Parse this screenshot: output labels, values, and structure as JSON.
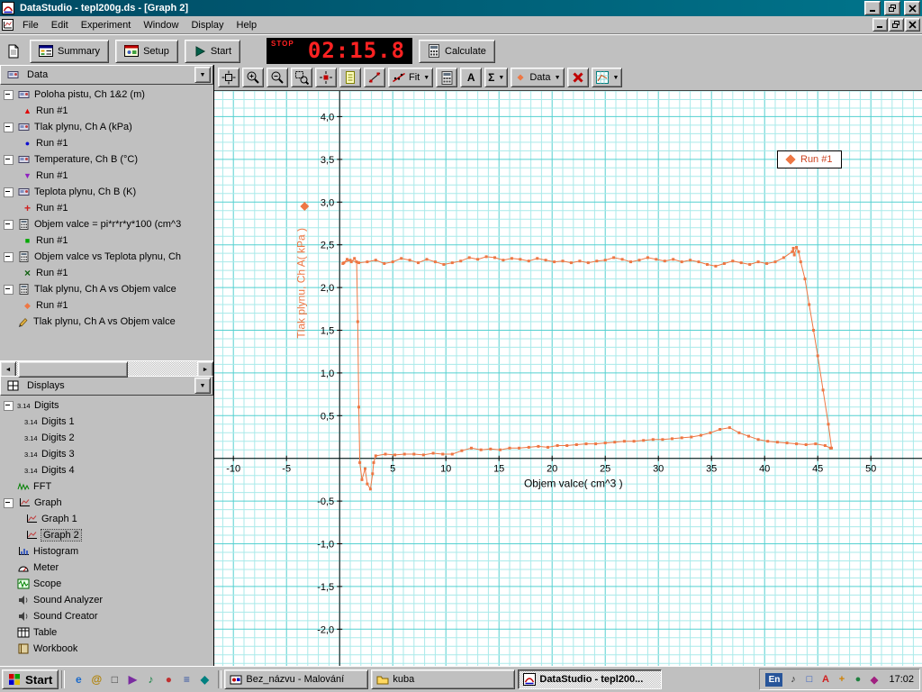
{
  "window": {
    "title": "DataStudio - tepl200g.ds - [Graph 2]"
  },
  "menu": {
    "items": [
      "File",
      "Edit",
      "Experiment",
      "Window",
      "Display",
      "Help"
    ]
  },
  "toolbar": {
    "summary": "Summary",
    "setup": "Setup",
    "start": "Start",
    "calculate": "Calculate",
    "timer_stop": "STOP",
    "timer_value": "02:15.8"
  },
  "graph_toolbar": {
    "buttons": [
      {
        "name": "scale-to-fit-button",
        "icon": "fitview"
      },
      {
        "name": "zoom-in-button",
        "icon": "zoomin"
      },
      {
        "name": "zoom-out-button",
        "icon": "zoomout"
      },
      {
        "name": "zoom-select-button",
        "icon": "zoomsel"
      },
      {
        "name": "smart-tool-button",
        "icon": "smart"
      },
      {
        "name": "note-tool-button",
        "icon": "note"
      },
      {
        "name": "slope-tool-button",
        "icon": "slope"
      },
      {
        "name": "fit-menu-button",
        "icon": "fitline",
        "label": "Fit",
        "dropdown": true
      },
      {
        "name": "calculator-tool-button",
        "icon": "calc"
      },
      {
        "name": "text-annotation-button",
        "label": "A",
        "bold": true
      },
      {
        "name": "statistics-menu-button",
        "label": "Σ",
        "bold": true,
        "dropdown": true
      },
      {
        "name": "data-menu-button",
        "icon": "datadiamond",
        "label": "Data",
        "dropdown": true
      },
      {
        "name": "delete-button",
        "icon": "delx"
      },
      {
        "name": "graph-settings-button",
        "icon": "gridset",
        "dropdown": true
      }
    ]
  },
  "sidebar": {
    "data_panel": {
      "title": "Data",
      "items": [
        {
          "icon": "sensor",
          "label": "Poloha pistu, Ch 1&2 (m)",
          "runs": [
            {
              "marker": "triangle-up",
              "color": "#e00000",
              "label": "Run #1"
            }
          ]
        },
        {
          "icon": "sensor",
          "label": "Tlak plynu, Ch A (kPa)",
          "runs": [
            {
              "marker": "circle",
              "color": "#1010d0",
              "label": "Run #1"
            }
          ]
        },
        {
          "icon": "sensor",
          "label": "Temperature, Ch B (°C)",
          "runs": [
            {
              "marker": "triangle-down",
              "color": "#9020c0",
              "label": "Run #1"
            }
          ]
        },
        {
          "icon": "sensor",
          "label": "Teplota plynu, Ch B (K)",
          "runs": [
            {
              "marker": "plus",
              "color": "#d02020",
              "label": "Run #1"
            }
          ]
        },
        {
          "icon": "calculator",
          "label": "Objem valce = pi*r*r*y*100 (cm^3",
          "runs": [
            {
              "marker": "square",
              "color": "#00a800",
              "label": "Run #1"
            }
          ]
        },
        {
          "icon": "calculator",
          "label": "Objem valce vs Teplota plynu, Ch",
          "runs": [
            {
              "marker": "x",
              "color": "#106010",
              "label": "Run #1"
            }
          ]
        },
        {
          "icon": "calculator",
          "label": "Tlak plynu, Ch A vs Objem valce",
          "runs": [
            {
              "marker": "diamond",
              "color": "#ee7744",
              "label": "Run #1"
            }
          ]
        },
        {
          "icon": "pen",
          "label": "Tlak plynu, Ch A vs Objem valce",
          "runs": []
        }
      ]
    },
    "displays_panel": {
      "title": "Displays",
      "items": [
        {
          "icon": "digits",
          "label": "Digits",
          "children": [
            {
              "icon": "digits",
              "label": "Digits 1"
            },
            {
              "icon": "digits",
              "label": "Digits 2"
            },
            {
              "icon": "digits",
              "label": "Digits 3"
            },
            {
              "icon": "digits",
              "label": "Digits 4"
            }
          ]
        },
        {
          "icon": "fft",
          "label": "FFT"
        },
        {
          "icon": "graph",
          "label": "Graph",
          "children": [
            {
              "icon": "graph",
              "label": "Graph 1"
            },
            {
              "icon": "graph",
              "label": "Graph 2",
              "selected": true
            }
          ]
        },
        {
          "icon": "histogram",
          "label": "Histogram"
        },
        {
          "icon": "meter",
          "label": "Meter"
        },
        {
          "icon": "scope",
          "label": "Scope"
        },
        {
          "icon": "speaker",
          "label": "Sound Analyzer"
        },
        {
          "icon": "speaker",
          "label": "Sound Creator"
        },
        {
          "icon": "table",
          "label": "Table"
        },
        {
          "icon": "workbook",
          "label": "Workbook"
        }
      ]
    }
  },
  "chart_data": {
    "type": "scatter",
    "title": "",
    "xlabel": "Objem valce( cm^3 )",
    "ylabel": "Tlak plynu, Ch A( kPa )",
    "legend": "Run #1",
    "series_color": "#ee7744",
    "grid_minor": "#aaeaea",
    "grid_major": "#55d0d0",
    "xlim": [
      -10,
      50
    ],
    "ylim": [
      -2,
      4
    ],
    "xview": [
      -11.8,
      54.9
    ],
    "yview": [
      -2.45,
      4.3
    ],
    "x_tick_step": 5,
    "y_tick_step": 0.5,
    "decimal_comma": true,
    "points": [
      [
        0.3,
        2.28
      ],
      [
        0.7,
        2.33
      ],
      [
        1.1,
        2.3
      ],
      [
        1.4,
        2.34
      ],
      [
        1.6,
        2.3
      ],
      [
        1.7,
        1.6
      ],
      [
        1.8,
        0.6
      ],
      [
        1.9,
        -0.05
      ],
      [
        2.1,
        -0.25
      ],
      [
        2.4,
        -0.12
      ],
      [
        2.6,
        -0.3
      ],
      [
        2.9,
        -0.36
      ],
      [
        3.1,
        -0.18
      ],
      [
        3.2,
        -0.05
      ],
      [
        3.4,
        0.03
      ],
      [
        4.3,
        0.05
      ],
      [
        5.2,
        0.04
      ],
      [
        6.1,
        0.05
      ],
      [
        7.0,
        0.05
      ],
      [
        7.9,
        0.04
      ],
      [
        8.8,
        0.06
      ],
      [
        9.7,
        0.05
      ],
      [
        10.6,
        0.05
      ],
      [
        11.5,
        0.09
      ],
      [
        12.4,
        0.12
      ],
      [
        13.3,
        0.1
      ],
      [
        14.2,
        0.11
      ],
      [
        15.1,
        0.1
      ],
      [
        16.0,
        0.12
      ],
      [
        16.9,
        0.12
      ],
      [
        17.8,
        0.13
      ],
      [
        18.7,
        0.14
      ],
      [
        19.6,
        0.13
      ],
      [
        20.5,
        0.15
      ],
      [
        21.4,
        0.15
      ],
      [
        22.3,
        0.16
      ],
      [
        23.2,
        0.17
      ],
      [
        24.1,
        0.17
      ],
      [
        25.0,
        0.18
      ],
      [
        25.9,
        0.19
      ],
      [
        26.8,
        0.2
      ],
      [
        27.7,
        0.2
      ],
      [
        28.6,
        0.21
      ],
      [
        29.5,
        0.22
      ],
      [
        30.4,
        0.22
      ],
      [
        31.3,
        0.23
      ],
      [
        32.2,
        0.24
      ],
      [
        33.1,
        0.25
      ],
      [
        34.0,
        0.27
      ],
      [
        34.9,
        0.3
      ],
      [
        35.8,
        0.34
      ],
      [
        36.7,
        0.36
      ],
      [
        37.6,
        0.3
      ],
      [
        38.5,
        0.26
      ],
      [
        39.4,
        0.22
      ],
      [
        40.3,
        0.2
      ],
      [
        41.2,
        0.19
      ],
      [
        42.1,
        0.18
      ],
      [
        43.0,
        0.17
      ],
      [
        43.9,
        0.16
      ],
      [
        44.8,
        0.17
      ],
      [
        45.7,
        0.15
      ],
      [
        46.2,
        0.12
      ],
      [
        46.3,
        0.12
      ],
      [
        46.0,
        0.4
      ],
      [
        45.5,
        0.8
      ],
      [
        45.0,
        1.2
      ],
      [
        44.6,
        1.5
      ],
      [
        44.2,
        1.8
      ],
      [
        43.8,
        2.1
      ],
      [
        43.4,
        2.3
      ],
      [
        43.2,
        2.42
      ],
      [
        43.0,
        2.47
      ],
      [
        42.8,
        2.38
      ],
      [
        42.7,
        2.46
      ],
      [
        42.6,
        2.42
      ],
      [
        41.8,
        2.35
      ],
      [
        41.0,
        2.3
      ],
      [
        40.2,
        2.28
      ],
      [
        39.4,
        2.3
      ],
      [
        38.6,
        2.27
      ],
      [
        37.8,
        2.29
      ],
      [
        37.0,
        2.31
      ],
      [
        36.2,
        2.28
      ],
      [
        35.4,
        2.25
      ],
      [
        34.6,
        2.27
      ],
      [
        33.8,
        2.3
      ],
      [
        33.0,
        2.32
      ],
      [
        32.2,
        2.3
      ],
      [
        31.4,
        2.33
      ],
      [
        30.6,
        2.31
      ],
      [
        29.8,
        2.33
      ],
      [
        29.0,
        2.35
      ],
      [
        28.2,
        2.32
      ],
      [
        27.4,
        2.3
      ],
      [
        26.6,
        2.33
      ],
      [
        25.8,
        2.35
      ],
      [
        25.0,
        2.32
      ],
      [
        24.2,
        2.31
      ],
      [
        23.4,
        2.29
      ],
      [
        22.6,
        2.31
      ],
      [
        21.8,
        2.29
      ],
      [
        21.0,
        2.31
      ],
      [
        20.2,
        2.3
      ],
      [
        19.4,
        2.32
      ],
      [
        18.6,
        2.34
      ],
      [
        17.8,
        2.31
      ],
      [
        17.0,
        2.33
      ],
      [
        16.2,
        2.34
      ],
      [
        15.4,
        2.32
      ],
      [
        14.6,
        2.35
      ],
      [
        13.8,
        2.36
      ],
      [
        13.0,
        2.33
      ],
      [
        12.2,
        2.35
      ],
      [
        11.4,
        2.31
      ],
      [
        10.6,
        2.29
      ],
      [
        9.8,
        2.27
      ],
      [
        9.0,
        2.3
      ],
      [
        8.2,
        2.33
      ],
      [
        7.4,
        2.29
      ],
      [
        6.6,
        2.32
      ],
      [
        5.8,
        2.34
      ],
      [
        5.0,
        2.3
      ],
      [
        4.2,
        2.28
      ],
      [
        3.4,
        2.32
      ],
      [
        2.6,
        2.3
      ],
      [
        1.8,
        2.29
      ],
      [
        1.0,
        2.32
      ],
      [
        0.4,
        2.29
      ]
    ]
  },
  "taskbar": {
    "start_label": "Start",
    "quick_launch": [
      {
        "name": "internet-explorer-icon",
        "glyph": "e",
        "color": "#1b6acb"
      },
      {
        "name": "mail-icon",
        "glyph": "@",
        "color": "#b08000"
      },
      {
        "name": "show-desktop-icon",
        "glyph": "□",
        "color": "#404040"
      },
      {
        "name": "media-player-icon",
        "glyph": "▶",
        "color": "#7a2ca0"
      },
      {
        "name": "sound-recorder-icon",
        "glyph": "♪",
        "color": "#108040"
      },
      {
        "name": "browser-icon",
        "glyph": "●",
        "color": "#c03030"
      },
      {
        "name": "document-icon",
        "glyph": "≡",
        "color": "#3050a0"
      },
      {
        "name": "tools-icon",
        "glyph": "◆",
        "color": "#008080"
      }
    ],
    "tasks": [
      {
        "name": "task-paint",
        "label": "Bez_názvu - Malování",
        "icon": "paint",
        "active": false
      },
      {
        "name": "task-folder-kuba",
        "label": "kuba",
        "icon": "folder",
        "active": false
      },
      {
        "name": "task-datastudio",
        "label": "DataStudio - tepl200...",
        "icon": "datastudio",
        "active": true
      }
    ],
    "tray": {
      "language": "En",
      "icons": [
        {
          "name": "volume-icon",
          "glyph": "♪",
          "color": "#303030"
        },
        {
          "name": "display-icon",
          "glyph": "□",
          "color": "#2050c0"
        },
        {
          "name": "antivirus-icon",
          "glyph": "A",
          "color": "#d02020"
        },
        {
          "name": "scheduler-icon",
          "glyph": "+",
          "color": "#d08000"
        },
        {
          "name": "network-icon",
          "glyph": "●",
          "color": "#208040"
        },
        {
          "name": "update-icon",
          "glyph": "◆",
          "color": "#a02080"
        }
      ],
      "clock": "17:02"
    }
  }
}
